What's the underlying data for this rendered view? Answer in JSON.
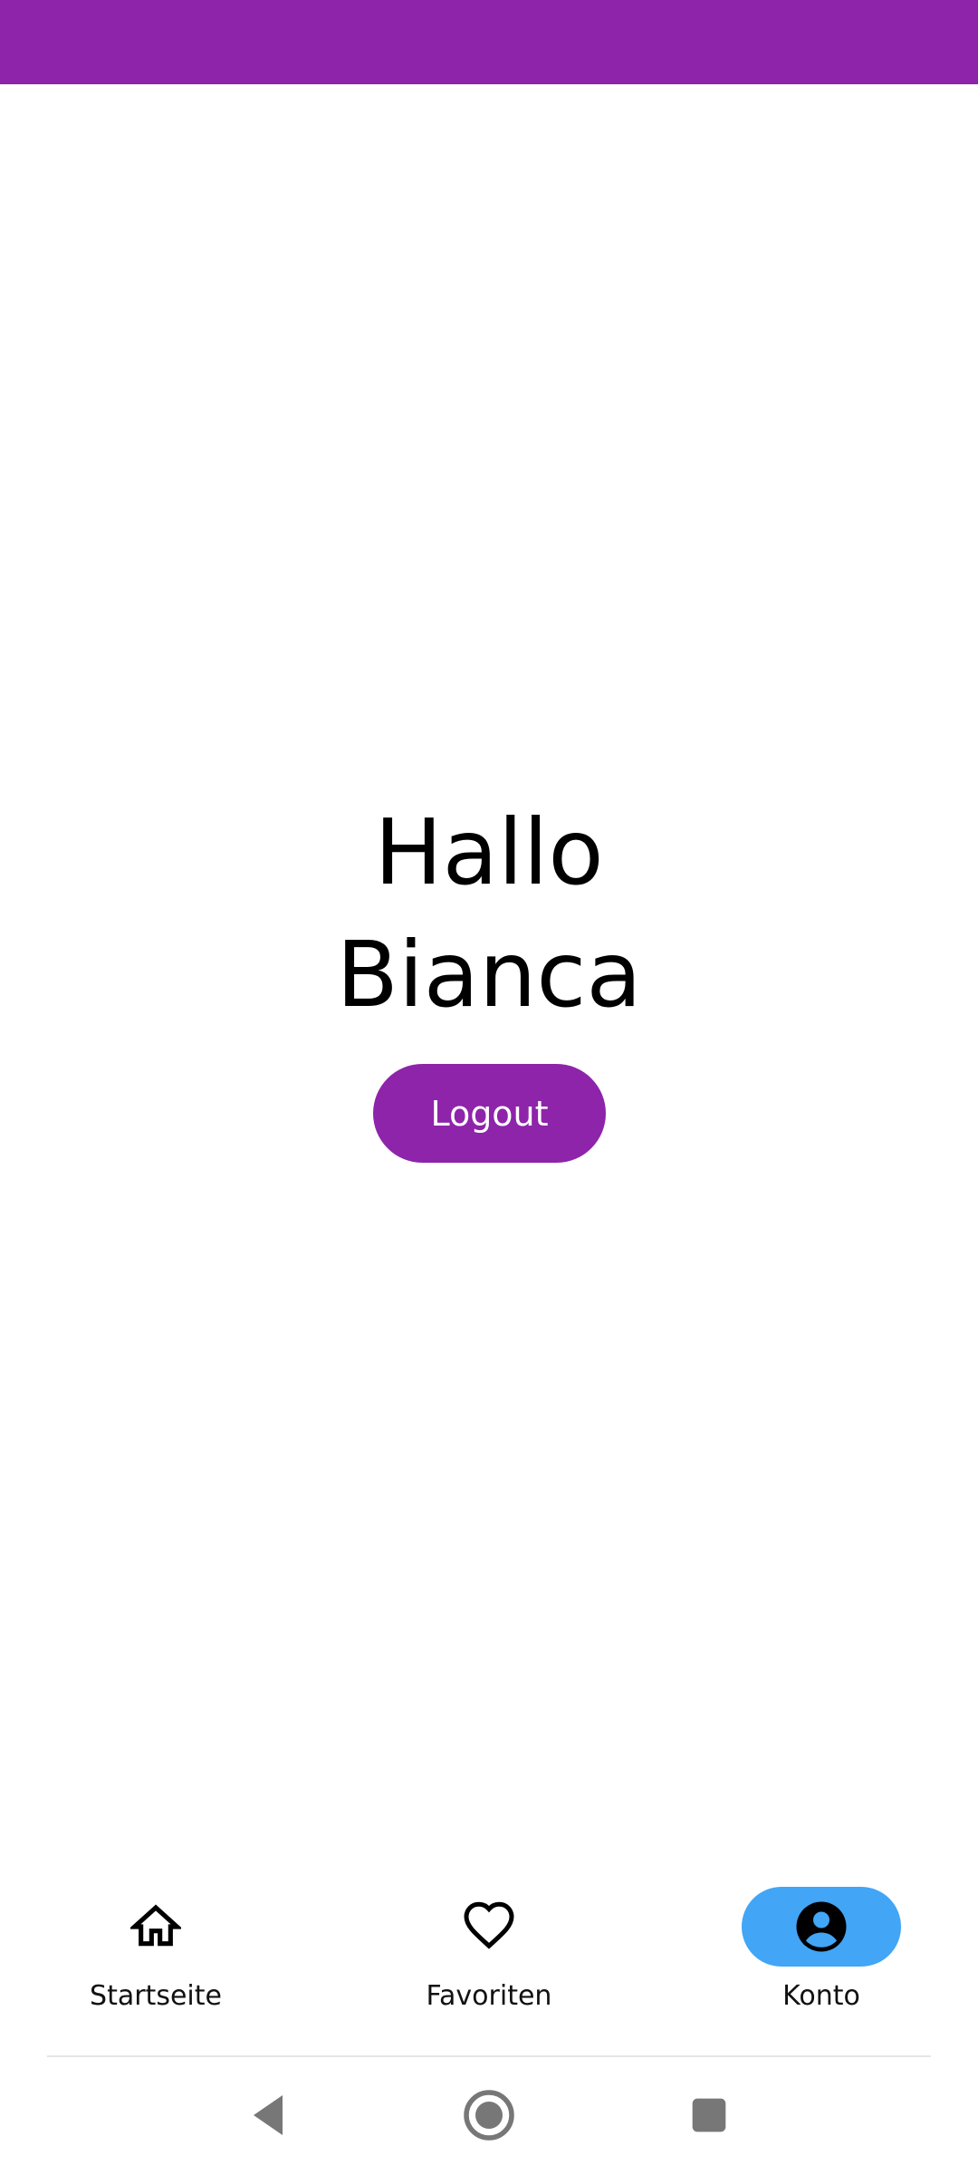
{
  "colors": {
    "status_bar": "#8E24AA",
    "primary": "#8E24AA",
    "active_nav": "#42A5F5",
    "system_nav": "#777777"
  },
  "greeting": {
    "line1": "Hallo",
    "line2": "Bianca"
  },
  "logout": {
    "label": "Logout"
  },
  "bottom_nav": {
    "items": [
      {
        "label": "Startseite",
        "icon": "home-icon",
        "active": false
      },
      {
        "label": "Favoriten",
        "icon": "heart-icon",
        "active": false
      },
      {
        "label": "Konto",
        "icon": "account-circle-icon",
        "active": true
      }
    ]
  },
  "system_nav": {
    "icons": [
      "back-icon",
      "home-circle-icon",
      "recents-icon"
    ]
  }
}
